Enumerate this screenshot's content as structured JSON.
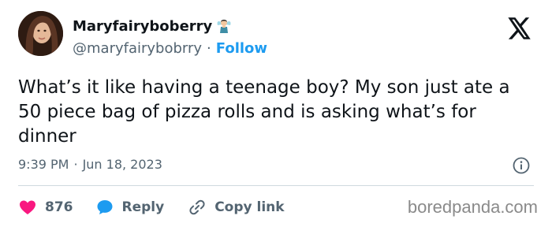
{
  "author": {
    "display_name": "Maryfairyboberry",
    "badge_emoji": "fairy-emoji",
    "handle": "@maryfairybobrry",
    "separator": "·",
    "follow_label": "Follow"
  },
  "tweet": {
    "text": "What’s it like having a teenage boy? My son just ate a 50 piece bag of pizza rolls and is asking what’s for dinner",
    "time": "9:39 PM",
    "meta_separator": "·",
    "date": "Jun 18, 2023"
  },
  "actions": {
    "like_count": "876",
    "reply_label": "Reply",
    "copy_link_label": "Copy link"
  },
  "watermark": "boredpanda.com",
  "colors": {
    "link_blue": "#1d9bf0",
    "like_pink": "#f91880",
    "secondary_text": "#536471"
  }
}
